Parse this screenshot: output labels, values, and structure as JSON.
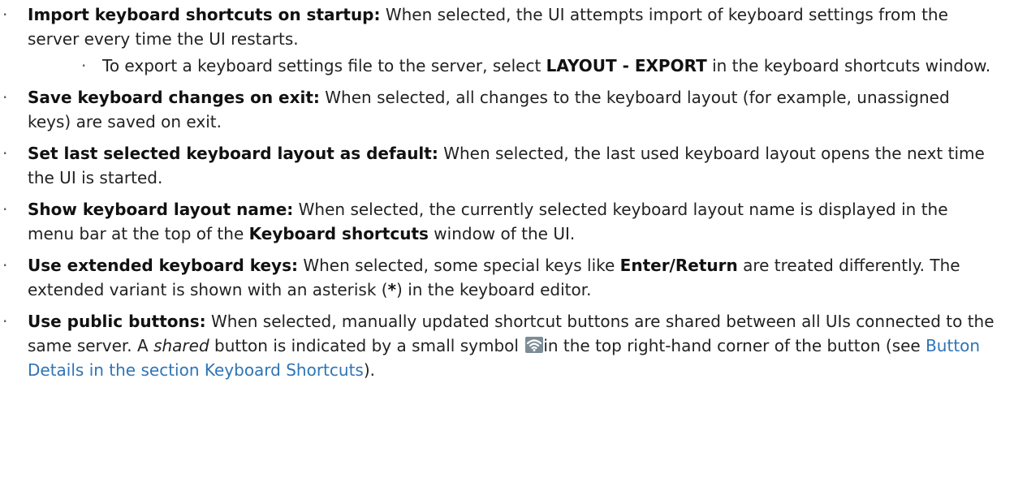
{
  "items": [
    {
      "term": "Import keyboard shortcuts on startup:",
      "text": " When selected, the UI attempts import of keyboard settings from the server every time the UI restarts.",
      "sub": {
        "text_1": "To export a keyboard settings file to the server, select ",
        "keyword": "LAYOUT - EXPORT",
        "text_2": " in the keyboard shortcuts window."
      }
    },
    {
      "term": "Save keyboard changes on exit:",
      "text": " When selected, all changes to the keyboard layout (for example, unassigned keys) are saved on exit."
    },
    {
      "term": "Set last selected keyboard layout as default:",
      "text": " When selected, the last used keyboard layout opens the next time the UI is started."
    },
    {
      "term": "Show keyboard layout name:",
      "text_1": " When selected, the currently selected keyboard layout name is displayed in the menu bar at the top of the ",
      "keyword": "Keyboard shortcuts",
      "text_2": " window of the UI."
    },
    {
      "term": "Use extended keyboard keys:",
      "text_1": " When selected, some special keys like ",
      "keyword": "Enter/Return",
      "text_2": " are treated differently. The extended variant is shown with an asterisk (",
      "asterisk": "*",
      "text_3": ") in the keyboard editor."
    },
    {
      "term": "Use public buttons:",
      "text_1": " When selected, manually updated shortcut buttons are shared between all UIs connected to the same server. A ",
      "italic": "shared",
      "text_2": " button is indicated by a small symbol ",
      "icon": "wifi-icon",
      "text_3": "in the top right-hand corner of the button (see ",
      "link_1": "Button Details",
      "text_4": " in the section ",
      "link_2": "Keyboard Shortcuts",
      "text_5": ")."
    }
  ],
  "colors": {
    "link": "#2f74b5",
    "icon_bg": "#7d8c97",
    "text": "#222222"
  }
}
